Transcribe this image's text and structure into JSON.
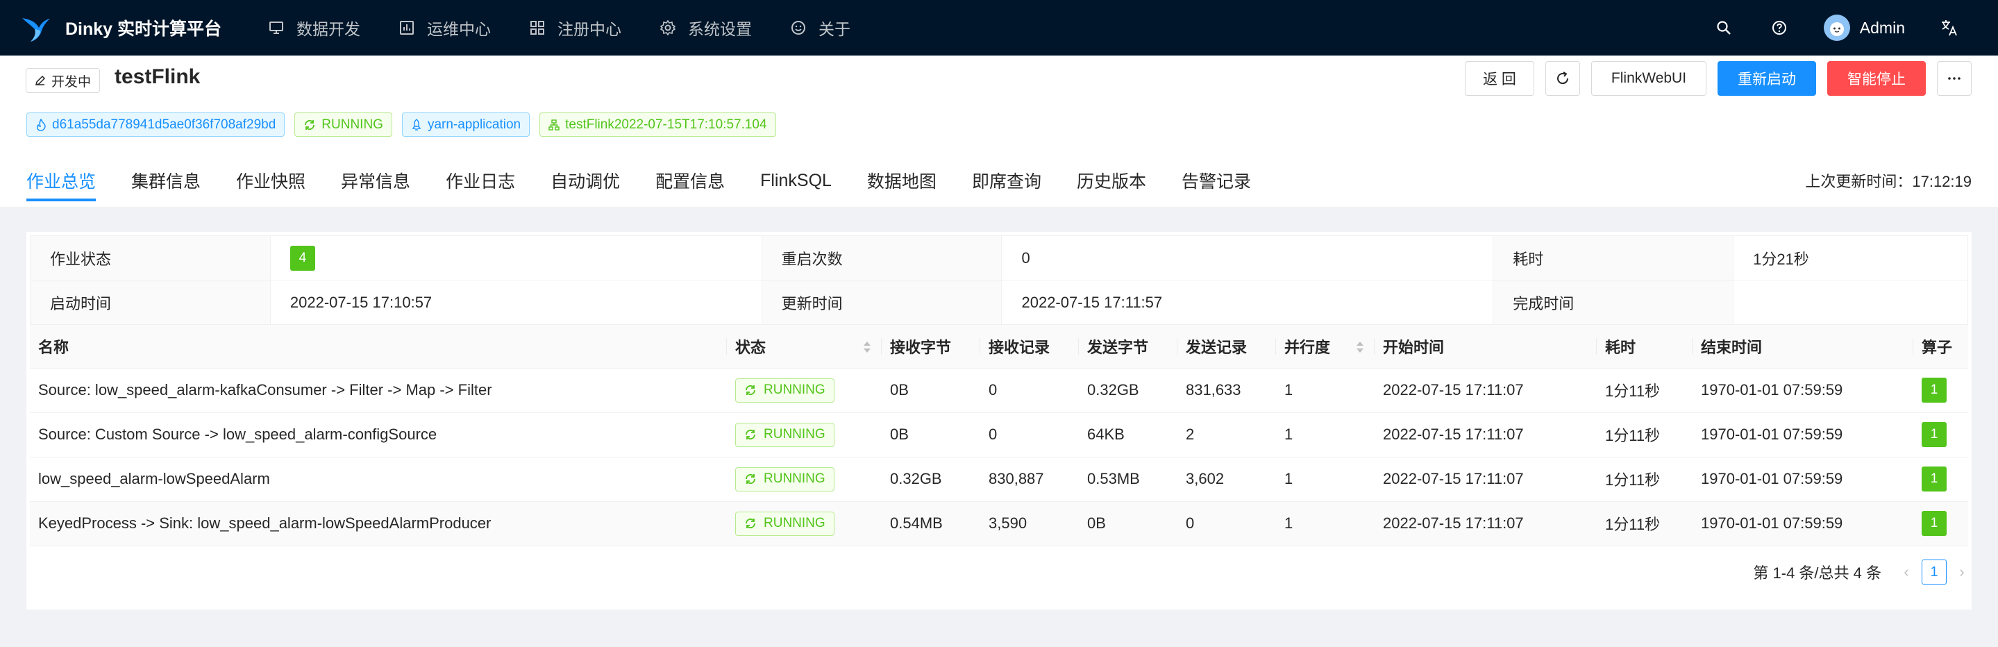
{
  "app": {
    "title": "Dinky 实时计算平台",
    "menu": [
      {
        "label": "数据开发",
        "icon": "monitor-icon"
      },
      {
        "label": "运维中心",
        "icon": "chart-icon"
      },
      {
        "label": "注册中心",
        "icon": "grid-icon"
      },
      {
        "label": "系统设置",
        "icon": "gear-icon"
      },
      {
        "label": "关于",
        "icon": "smile-icon"
      }
    ],
    "user": "Admin"
  },
  "header": {
    "edit_tag": "开发中",
    "title": "testFlink",
    "actions": {
      "back": "返 回",
      "webui": "FlinkWebUI",
      "restart": "重新启动",
      "stop": "智能停止"
    },
    "tags": {
      "job_id": "d61a55da778941d5ae0f36f708af29bd",
      "status": "RUNNING",
      "mode": "yarn-application",
      "name": "testFlink2022-07-15T17:10:57.104"
    },
    "tabs": [
      "作业总览",
      "集群信息",
      "作业快照",
      "异常信息",
      "作业日志",
      "自动调优",
      "配置信息",
      "FlinkSQL",
      "数据地图",
      "即席查询",
      "历史版本",
      "告警记录"
    ],
    "last_update_label": "上次更新时间：",
    "last_update": "17:12:19"
  },
  "overview": {
    "job_status_label": "作业状态",
    "job_status_value": "4",
    "restart_count_label": "重启次数",
    "restart_count_value": "0",
    "duration_label": "耗时",
    "duration_value": "1分21秒",
    "start_time_label": "启动时间",
    "start_time_value": "2022-07-15 17:10:57",
    "update_time_label": "更新时间",
    "update_time_value": "2022-07-15 17:11:57",
    "finish_time_label": "完成时间",
    "finish_time_value": ""
  },
  "table": {
    "headers": [
      "名称",
      "状态",
      "接收字节",
      "接收记录",
      "发送字节",
      "发送记录",
      "并行度",
      "开始时间",
      "耗时",
      "结束时间",
      "算子"
    ],
    "rows": [
      {
        "name": "Source: low_speed_alarm-kafkaConsumer -> Filter -> Map -> Filter",
        "status": "RUNNING",
        "recv_bytes": "0B",
        "recv_records": "0",
        "send_bytes": "0.32GB",
        "send_records": "831,633",
        "parallelism": "1",
        "start": "2022-07-15 17:11:07",
        "duration": "1分11秒",
        "end": "1970-01-01 07:59:59",
        "ops": "1"
      },
      {
        "name": "Source: Custom Source -> low_speed_alarm-configSource",
        "status": "RUNNING",
        "recv_bytes": "0B",
        "recv_records": "0",
        "send_bytes": "64KB",
        "send_records": "2",
        "parallelism": "1",
        "start": "2022-07-15 17:11:07",
        "duration": "1分11秒",
        "end": "1970-01-01 07:59:59",
        "ops": "1"
      },
      {
        "name": "low_speed_alarm-lowSpeedAlarm",
        "status": "RUNNING",
        "recv_bytes": "0.32GB",
        "recv_records": "830,887",
        "send_bytes": "0.53MB",
        "send_records": "3,602",
        "parallelism": "1",
        "start": "2022-07-15 17:11:07",
        "duration": "1分11秒",
        "end": "1970-01-01 07:59:59",
        "ops": "1"
      },
      {
        "name": "KeyedProcess -> Sink: low_speed_alarm-lowSpeedAlarmProducer",
        "status": "RUNNING",
        "recv_bytes": "0.54MB",
        "recv_records": "3,590",
        "send_bytes": "0B",
        "send_records": "0",
        "parallelism": "1",
        "start": "2022-07-15 17:11:07",
        "duration": "1分11秒",
        "end": "1970-01-01 07:59:59",
        "ops": "1"
      }
    ],
    "pagination": {
      "summary": "第 1-4 条/总共 4 条",
      "current": "1"
    }
  },
  "colors": {
    "primary": "#1890ff",
    "danger": "#ff4d4f",
    "success": "#52c41a",
    "nav_bg": "#001529"
  }
}
